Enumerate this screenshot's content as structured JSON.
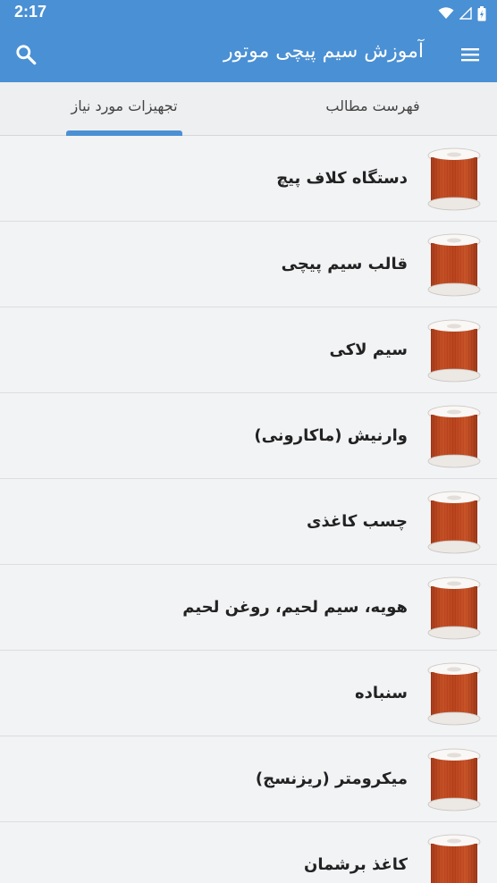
{
  "status": {
    "time": "2:17"
  },
  "appbar": {
    "title": "آموزش سیم پیچی موتور"
  },
  "tabs": [
    {
      "label": "فهرست مطالب",
      "selected": false
    },
    {
      "label": "تجهیزات مورد نیاز",
      "selected": true
    }
  ],
  "items": [
    {
      "label": "دستگاه کلاف پیچ"
    },
    {
      "label": "قالب سیم پیچی"
    },
    {
      "label": "سیم لاکی"
    },
    {
      "label": "وارنیش (ماکارونی)"
    },
    {
      "label": "چسب کاغذی"
    },
    {
      "label": "هویه، سیم لحیم، روغن لحیم"
    },
    {
      "label": "سنباده"
    },
    {
      "label": "میکرومتر (ریزنسج)"
    },
    {
      "label": "کاغذ برشمان"
    }
  ],
  "colors": {
    "accent": "#4a90d4",
    "background": "#f2f3f5",
    "copper": "#c2471e"
  }
}
